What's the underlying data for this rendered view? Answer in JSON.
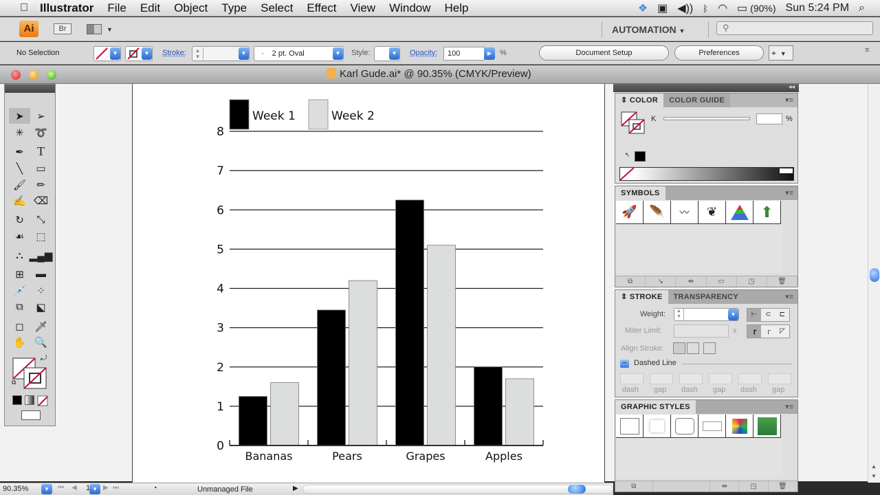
{
  "menubar": {
    "apple_icon": "apple-icon",
    "items": [
      "Illustrator",
      "File",
      "Edit",
      "Object",
      "Type",
      "Select",
      "Effect",
      "View",
      "Window",
      "Help"
    ],
    "status": {
      "battery": "(90%)",
      "clock": "Sun 5:24 PM"
    }
  },
  "appbar": {
    "ai_logo": "Ai",
    "bridge": "Br",
    "workspace": "AUTOMATION",
    "search_placeholder": ""
  },
  "controlbar": {
    "selection": "No Selection",
    "stroke_label": "Stroke:",
    "stroke_value": "",
    "brush": "2 pt. Oval",
    "brush_bullet": "·",
    "style_label": "Style:",
    "opacity_label": "Opacity:",
    "opacity_value": "100",
    "percent": "%",
    "document_setup": "Document Setup",
    "preferences": "Preferences"
  },
  "document": {
    "title": "Karl Gude.ai* @ 90.35% (CMYK/Preview)"
  },
  "panels": {
    "color": {
      "tabs": [
        "COLOR",
        "COLOR GUIDE"
      ],
      "active_prefix": "⇕",
      "channel": "K",
      "value": "",
      "percent": "%"
    },
    "symbols": {
      "tab": "SYMBOLS",
      "items": [
        "rocket",
        "feather",
        "banner",
        "skull-wing",
        "pyramid",
        "arrow-up"
      ]
    },
    "stroke": {
      "tabs": [
        "STROKE",
        "TRANSPARENCY"
      ],
      "active_prefix": "⇕",
      "weight_label": "Weight:",
      "weight_value": "",
      "miter_label": "Miter Limit:",
      "miter_suffix": "x",
      "align_label": "Align Stroke:",
      "dashed_label": "Dashed Line",
      "dash_labels": [
        "dash",
        "gap",
        "dash",
        "gap",
        "dash",
        "gap"
      ]
    },
    "graphic_styles": {
      "tab": "GRAPHIC STYLES"
    }
  },
  "statusbar": {
    "zoom": "90.35%",
    "artboard": "1",
    "file_status": "Unmanaged File"
  },
  "chart_data": {
    "type": "bar",
    "title": "",
    "xlabel": "",
    "ylabel": "",
    "categories": [
      "Bananas",
      "Pears",
      "Grapes",
      "Apples"
    ],
    "series": [
      {
        "name": "Week 1",
        "color": "#000000",
        "values": [
          1.25,
          3.45,
          6.25,
          2.0
        ]
      },
      {
        "name": "Week 2",
        "color": "#dcdedd",
        "values": [
          1.6,
          4.2,
          5.1,
          1.7
        ]
      }
    ],
    "yticks": [
      "0",
      "1",
      "2",
      "3",
      "4",
      "5",
      "6",
      "7",
      "8"
    ],
    "ylim": [
      0,
      8
    ],
    "grid": true,
    "legend": "top-left"
  }
}
